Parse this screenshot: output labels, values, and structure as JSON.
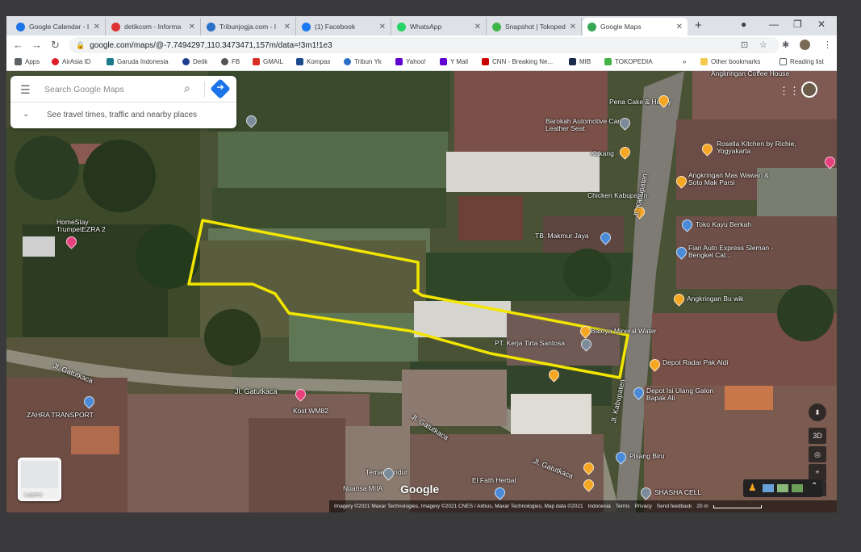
{
  "browser": {
    "tabs": [
      {
        "title": "Google Calendar - I",
        "color": "#1a73e8"
      },
      {
        "title": "detikcom - Informa",
        "color": "#d33"
      },
      {
        "title": "Tribunjogja.com - I",
        "color": "#2a6fc9"
      },
      {
        "title": "(1) Facebook",
        "color": "#1877f2"
      },
      {
        "title": "WhatsApp",
        "color": "#25d366"
      },
      {
        "title": "Snapshot | Tokoped",
        "color": "#42b549"
      },
      {
        "title": "Google Maps",
        "color": "#34a853",
        "active": true
      }
    ],
    "new_tab": "+",
    "url": "google.com/maps/@-7.7494297,110.3473471,157m/data=!3m1!1e3",
    "bookmarks": [
      {
        "label": "Apps",
        "color": "#5f6368"
      },
      {
        "label": "AirAsia ID",
        "color": "#e11d2a"
      },
      {
        "label": "Garuda Indonesia",
        "color": "#1b7a8c"
      },
      {
        "label": "Detik",
        "color": "#1d3e8f"
      },
      {
        "label": "FB",
        "color": "#555"
      },
      {
        "label": "GMAIL",
        "color": "#d93025"
      },
      {
        "label": "Kompas",
        "color": "#1a4b8c"
      },
      {
        "label": "Tribun Yk",
        "color": "#2a6fc9"
      },
      {
        "label": "Yahoo!",
        "color": "#6001d2"
      },
      {
        "label": "Y Mail",
        "color": "#6001d2"
      },
      {
        "label": "CNN - Breaking Ne...",
        "color": "#cc0000"
      },
      {
        "label": "MIB",
        "color": "#1b2a4a"
      },
      {
        "label": "TOKOPEDIA",
        "color": "#42b549"
      }
    ],
    "more_bookmarks": "»",
    "other_bookmarks": "Other bookmarks",
    "reading_list": "Reading list"
  },
  "search": {
    "placeholder": "Search Google Maps",
    "hint": "See travel times, traffic and nearby places"
  },
  "map_labels": {
    "places": [
      "Pena Cake & Hobby",
      "Barokah Automotive Car Leather Seat",
      "Kakang",
      "Rosella Kitchen by Richie, Yogyakarta",
      "Angkringan Mas Wawan & Soto Mak Parsi",
      "Chicken Kabupaten",
      "Toko Kayu Berkah",
      "TB. Makmur Jaya",
      "Fian Auto Express Sleman - Bengkel Cat...",
      "Angkringan Bu wik",
      "Batoya Mineral Water",
      "PT. Kerja Tirta Santosa",
      "Depot Radar Pak Aldi",
      "Depot Isi Ulang Galon Bapak Ali",
      "HomeStay TrumpetEZRA 2",
      "Kost WM82",
      "ZAHRA TRANSPORT",
      "Pisang Biru",
      "Temannandur",
      "Nuansa MIIA",
      "El Fath Herbal",
      "SHASHA CELL",
      "Angkringan Coffee House"
    ],
    "roads": [
      "Jl. Kabupaten",
      "Jl. Kabupaten",
      "Jl. Gatutkaca",
      "Jl. Gatutkaca",
      "Jl. Gatutkaca",
      "Jl. Gatutkaca"
    ]
  },
  "controls": {
    "layers": "Layers",
    "three_d": "3D",
    "zoom_in": "+",
    "zoom_out": "−",
    "google_logo": "Google",
    "attribution": "Imagery ©2021 Maxar Technologies, Imagery ©2021 CNES / Airbus, Maxar Technologies, Map data ©2021",
    "country": "Indonesia",
    "terms": "Terms",
    "privacy": "Privacy",
    "feedback": "Send feedback",
    "scale": "20 m"
  },
  "highlight_color": "#f2e600"
}
